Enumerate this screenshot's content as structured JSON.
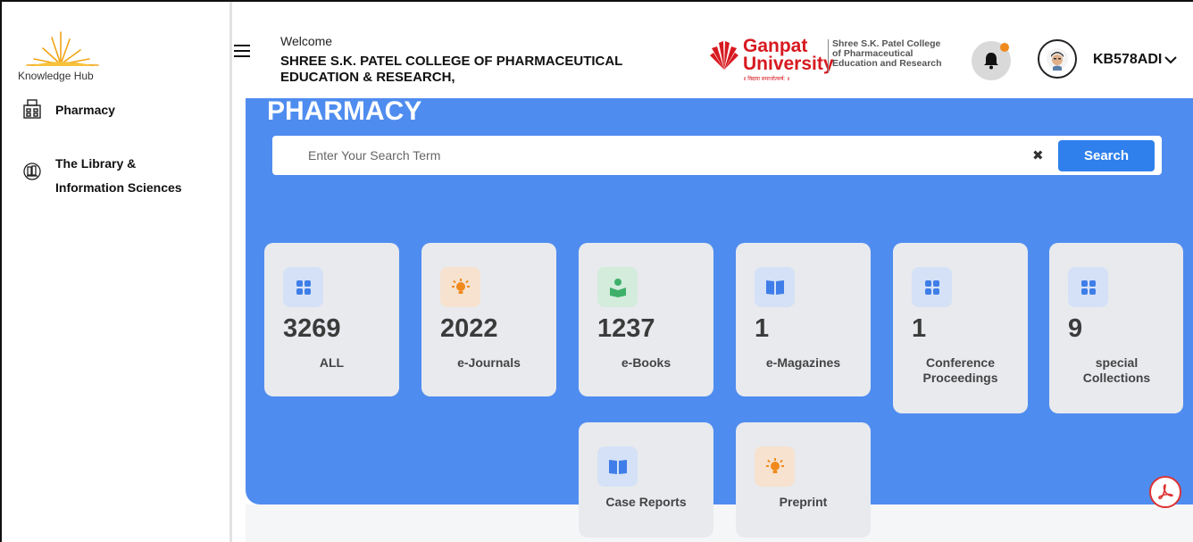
{
  "sidebar": {
    "logo_text": "Knowledge Hub",
    "items": [
      {
        "label": "Pharmacy"
      },
      {
        "label": "The Library &"
      },
      {
        "label": "Information Sciences"
      }
    ]
  },
  "header": {
    "welcome": "Welcome",
    "college_line1": "SHREE S.K. PATEL COLLEGE OF PHARMACEUTICAL",
    "college_line2": "EDUCATION & RESEARCH,",
    "university_word1": "Ganpat",
    "university_word2": "University",
    "university_tagline": "॥ विद्यया समाजोत्कर्ष: ॥",
    "college_logo_line1": "Shree S.K. Patel College",
    "college_logo_line2": "of Pharmaceutical",
    "college_logo_line3": "Education and Research",
    "username": "KB578ADI"
  },
  "main": {
    "title": "PHARMACY",
    "search": {
      "placeholder": "Enter Your Search Term",
      "clear": "✖",
      "button": "Search"
    },
    "cards": [
      {
        "count": "3269",
        "label1": "ALL",
        "label2": "",
        "icon": "grid-icon"
      },
      {
        "count": "2022",
        "label1": "e-Journals",
        "label2": "",
        "icon": "bulb-icon"
      },
      {
        "count": "1237",
        "label1": "e-Books",
        "label2": "",
        "icon": "reader-icon"
      },
      {
        "count": "1",
        "label1": "e-Magazines",
        "label2": "",
        "icon": "book-icon"
      },
      {
        "count": "1",
        "label1": "Conference",
        "label2": "Proceedings",
        "icon": "grid-icon"
      },
      {
        "count": "9",
        "label1": "special",
        "label2": "Collections",
        "icon": "grid-icon"
      },
      {
        "count": "",
        "label1": "Case Reports",
        "label2": "",
        "icon": "book-icon"
      },
      {
        "count": "",
        "label1": "Preprint",
        "label2": "",
        "icon": "bulb-icon"
      }
    ]
  },
  "colors": {
    "accent": "#4f8cef",
    "button": "#2f80ed",
    "brand_red": "#d71920",
    "card": "#e8eaee"
  }
}
